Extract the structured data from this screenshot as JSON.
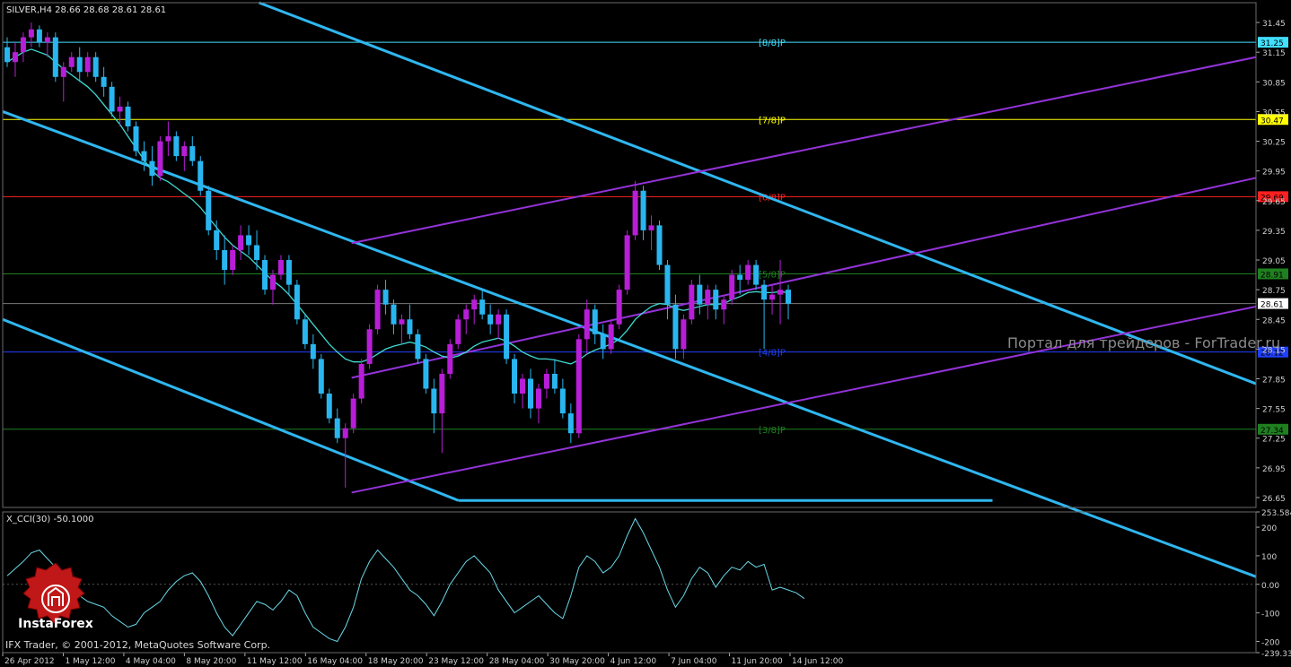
{
  "main_title": "SILVER,H4  28.66 28.68 28.61 28.61",
  "sub_title": "X_CCI(30) -50.1000",
  "watermark": "Портал для трейдеров - ForTrader.ru",
  "footer": "IFX Trader, © 2001-2012, MetaQuotes Software Corp.",
  "logo_text": "InstaForex",
  "price_ticks": [
    "31.45",
    "31.15",
    "30.85",
    "30.55",
    "30.25",
    "29.95",
    "29.65",
    "29.35",
    "29.05",
    "28.75",
    "28.45",
    "28.15",
    "27.85",
    "27.55",
    "27.25",
    "26.95",
    "26.65"
  ],
  "cci_ticks": [
    "253.584",
    "200",
    "100",
    "0.00",
    "-100",
    "-200",
    "-239.334"
  ],
  "x_ticks": [
    "26 Apr 2012",
    "1 May 12:00",
    "4 May 04:00",
    "8 May 20:00",
    "11 May 12:00",
    "16 May 04:00",
    "18 May 20:00",
    "23 May 12:00",
    "28 May 04:00",
    "30 May 20:00",
    "4 Jun 12:00",
    "7 Jun 04:00",
    "11 Jun 20:00",
    "14 Jun 12:00"
  ],
  "colors": {
    "background": "#000000",
    "bull": "#b81ed8",
    "bear": "#29b6f0",
    "ma": "#40d8d0",
    "cci": "#6ad8e8",
    "channel_blue": "#2fb7f0",
    "channel_purple": "#9333d8",
    "axis_text": "#d0d0d0"
  },
  "chart_data": [
    {
      "type": "candlestick",
      "title": "SILVER,H4",
      "ylim": [
        26.55,
        31.65
      ],
      "x_range": [
        0,
        176
      ],
      "last_price": 28.61,
      "murray_levels": [
        {
          "label": "[8/8]P",
          "price": 31.25,
          "color": "#40e0ff",
          "box_text": "31.25"
        },
        {
          "label": "[7/8]P",
          "price": 30.47,
          "color": "#ffff00",
          "box_text": "30.47"
        },
        {
          "label": "[6/8]P",
          "price": 29.69,
          "color": "#ff2020",
          "box_text": "29.69"
        },
        {
          "label": "[5/8]P",
          "price": 28.91,
          "color": "#208020",
          "box_text": "28.91"
        },
        {
          "label": "[4/8]P",
          "price": 28.12,
          "color": "#2040ff",
          "box_text": "28.12"
        },
        {
          "label": "[3/8]P",
          "price": 27.34,
          "color": "#208020",
          "box_text": "27.34"
        }
      ],
      "trend_lines": [
        {
          "color": "blue",
          "p1": [
            36,
            31.65
          ],
          "p2": [
            176,
            27.8
          ]
        },
        {
          "color": "blue",
          "p1": [
            0,
            30.55
          ],
          "p2": [
            176,
            25.85
          ]
        },
        {
          "color": "blue",
          "p1": [
            0,
            28.45
          ],
          "p2": [
            64,
            26.62
          ]
        },
        {
          "color": "blue",
          "p1": [
            64,
            26.62
          ],
          "p2": [
            139,
            26.62
          ]
        },
        {
          "color": "purple",
          "p1": [
            49,
            29.22
          ],
          "p2": [
            176,
            31.1
          ]
        },
        {
          "color": "purple",
          "p1": [
            49,
            27.86
          ],
          "p2": [
            176,
            29.88
          ]
        },
        {
          "color": "purple",
          "p1": [
            49,
            26.7
          ],
          "p2": [
            176,
            28.58
          ]
        }
      ],
      "ohlc": [
        [
          31.2,
          31.3,
          31.0,
          31.05
        ],
        [
          31.05,
          31.25,
          30.9,
          31.15
        ],
        [
          31.15,
          31.35,
          31.05,
          31.3
        ],
        [
          31.3,
          31.45,
          31.2,
          31.38
        ],
        [
          31.38,
          31.42,
          31.2,
          31.25
        ],
        [
          31.25,
          31.35,
          31.1,
          31.3
        ],
        [
          31.3,
          31.35,
          30.85,
          30.9
        ],
        [
          30.9,
          31.05,
          30.65,
          31.0
        ],
        [
          31.0,
          31.15,
          30.95,
          31.1
        ],
        [
          31.1,
          31.2,
          30.85,
          30.95
        ],
        [
          30.95,
          31.15,
          30.9,
          31.1
        ],
        [
          31.1,
          31.15,
          30.85,
          30.9
        ],
        [
          30.9,
          31.0,
          30.7,
          30.8
        ],
        [
          30.8,
          30.85,
          30.5,
          30.55
        ],
        [
          30.55,
          30.7,
          30.4,
          30.6
        ],
        [
          30.6,
          30.65,
          30.35,
          30.4
        ],
        [
          30.4,
          30.45,
          30.1,
          30.15
        ],
        [
          30.15,
          30.25,
          29.95,
          30.05
        ],
        [
          30.05,
          30.2,
          29.8,
          29.9
        ],
        [
          29.9,
          30.3,
          29.85,
          30.25
        ],
        [
          30.25,
          30.45,
          30.1,
          30.3
        ],
        [
          30.3,
          30.35,
          30.05,
          30.1
        ],
        [
          30.1,
          30.25,
          29.95,
          30.2
        ],
        [
          30.2,
          30.3,
          30.0,
          30.05
        ],
        [
          30.05,
          30.1,
          29.7,
          29.75
        ],
        [
          29.75,
          29.8,
          29.3,
          29.35
        ],
        [
          29.35,
          29.45,
          29.05,
          29.15
        ],
        [
          29.15,
          29.3,
          28.8,
          28.95
        ],
        [
          28.95,
          29.2,
          28.9,
          29.15
        ],
        [
          29.15,
          29.4,
          29.05,
          29.3
        ],
        [
          29.3,
          29.4,
          29.1,
          29.2
        ],
        [
          29.2,
          29.35,
          28.95,
          29.05
        ],
        [
          29.05,
          29.1,
          28.7,
          28.75
        ],
        [
          28.75,
          28.95,
          28.6,
          28.9
        ],
        [
          28.9,
          29.1,
          28.85,
          29.05
        ],
        [
          29.05,
          29.1,
          28.7,
          28.8
        ],
        [
          28.8,
          28.85,
          28.4,
          28.45
        ],
        [
          28.45,
          28.5,
          28.15,
          28.2
        ],
        [
          28.2,
          28.3,
          27.95,
          28.05
        ],
        [
          28.05,
          28.1,
          27.65,
          27.7
        ],
        [
          27.7,
          27.75,
          27.4,
          27.45
        ],
        [
          27.45,
          27.55,
          27.2,
          27.25
        ],
        [
          27.25,
          27.4,
          26.75,
          27.35
        ],
        [
          27.35,
          27.7,
          27.3,
          27.65
        ],
        [
          27.65,
          28.05,
          27.6,
          28.0
        ],
        [
          28.0,
          28.4,
          27.95,
          28.35
        ],
        [
          28.35,
          28.8,
          28.3,
          28.75
        ],
        [
          28.75,
          28.85,
          28.5,
          28.6
        ],
        [
          28.6,
          28.65,
          28.3,
          28.4
        ],
        [
          28.4,
          28.5,
          28.2,
          28.45
        ],
        [
          28.45,
          28.6,
          28.25,
          28.3
        ],
        [
          28.3,
          28.35,
          28.0,
          28.05
        ],
        [
          28.05,
          28.1,
          27.7,
          27.75
        ],
        [
          27.75,
          27.85,
          27.3,
          27.5
        ],
        [
          27.5,
          27.95,
          27.1,
          27.9
        ],
        [
          27.9,
          28.25,
          27.85,
          28.2
        ],
        [
          28.2,
          28.5,
          28.15,
          28.45
        ],
        [
          28.45,
          28.6,
          28.3,
          28.55
        ],
        [
          28.55,
          28.7,
          28.4,
          28.65
        ],
        [
          28.65,
          28.75,
          28.45,
          28.5
        ],
        [
          28.5,
          28.6,
          28.3,
          28.4
        ],
        [
          28.4,
          28.55,
          28.25,
          28.5
        ],
        [
          28.5,
          28.55,
          28.0,
          28.05
        ],
        [
          28.05,
          28.1,
          27.6,
          27.7
        ],
        [
          27.7,
          27.9,
          27.55,
          27.85
        ],
        [
          27.85,
          27.95,
          27.45,
          27.55
        ],
        [
          27.55,
          27.8,
          27.4,
          27.75
        ],
        [
          27.75,
          27.95,
          27.65,
          27.9
        ],
        [
          27.9,
          28.05,
          27.7,
          27.75
        ],
        [
          27.75,
          27.85,
          27.45,
          27.5
        ],
        [
          27.5,
          27.6,
          27.2,
          27.3
        ],
        [
          27.3,
          28.3,
          27.25,
          28.25
        ],
        [
          28.25,
          28.65,
          28.1,
          28.55
        ],
        [
          28.55,
          28.6,
          28.2,
          28.3
        ],
        [
          28.3,
          28.4,
          28.05,
          28.15
        ],
        [
          28.15,
          28.45,
          28.1,
          28.4
        ],
        [
          28.4,
          28.8,
          28.35,
          28.75
        ],
        [
          28.75,
          29.35,
          28.7,
          29.3
        ],
        [
          29.3,
          29.85,
          29.25,
          29.75
        ],
        [
          29.75,
          29.8,
          29.25,
          29.35
        ],
        [
          29.35,
          29.5,
          29.15,
          29.4
        ],
        [
          29.4,
          29.45,
          28.95,
          29.0
        ],
        [
          29.0,
          29.05,
          28.45,
          28.6
        ],
        [
          28.6,
          28.7,
          28.05,
          28.15
        ],
        [
          28.15,
          28.5,
          28.05,
          28.45
        ],
        [
          28.45,
          28.85,
          28.4,
          28.8
        ],
        [
          28.8,
          28.9,
          28.5,
          28.6
        ],
        [
          28.6,
          28.8,
          28.45,
          28.75
        ],
        [
          28.75,
          28.8,
          28.45,
          28.55
        ],
        [
          28.55,
          28.7,
          28.4,
          28.65
        ],
        [
          28.65,
          28.95,
          28.6,
          28.9
        ],
        [
          28.9,
          29.0,
          28.7,
          28.85
        ],
        [
          28.85,
          29.05,
          28.8,
          29.0
        ],
        [
          29.0,
          29.05,
          28.75,
          28.8
        ],
        [
          28.8,
          28.85,
          28.15,
          28.65
        ],
        [
          28.65,
          28.8,
          28.5,
          28.7
        ],
        [
          28.7,
          29.05,
          28.4,
          28.75
        ],
        [
          28.75,
          28.8,
          28.45,
          28.61
        ]
      ],
      "ma": [
        31.05,
        31.1,
        31.15,
        31.18,
        31.15,
        31.12,
        31.05,
        30.98,
        30.92,
        30.86,
        30.8,
        30.72,
        30.62,
        30.52,
        30.42,
        30.3,
        30.18,
        30.06,
        29.95,
        29.88,
        29.84,
        29.78,
        29.72,
        29.66,
        29.58,
        29.48,
        29.38,
        29.28,
        29.2,
        29.14,
        29.08,
        29.0,
        28.92,
        28.84,
        28.78,
        28.7,
        28.6,
        28.5,
        28.4,
        28.3,
        28.2,
        28.12,
        28.05,
        28.02,
        28.02,
        28.05,
        28.1,
        28.15,
        28.18,
        28.2,
        28.22,
        28.2,
        28.17,
        28.12,
        28.08,
        28.06,
        28.08,
        28.12,
        28.18,
        28.22,
        28.24,
        28.26,
        28.23,
        28.18,
        28.12,
        28.08,
        28.05,
        28.05,
        28.04,
        28.02,
        28.0,
        28.04,
        28.1,
        28.14,
        28.17,
        28.2,
        28.25,
        28.34,
        28.45,
        28.52,
        28.58,
        28.61,
        28.6,
        28.56,
        28.54,
        28.56,
        28.58,
        28.6,
        28.6,
        28.61,
        28.65,
        28.68,
        28.72,
        28.73,
        28.72,
        28.72,
        28.73,
        28.72
      ]
    },
    {
      "type": "line",
      "title": "X_CCI(30) -50.1000",
      "ylim": [
        -239.334,
        253.584
      ],
      "zero_line": 0,
      "values": [
        30,
        55,
        80,
        110,
        120,
        90,
        60,
        20,
        -10,
        -40,
        -60,
        -70,
        -80,
        -110,
        -130,
        -150,
        -140,
        -100,
        -80,
        -60,
        -20,
        10,
        30,
        40,
        10,
        -40,
        -100,
        -150,
        -180,
        -140,
        -100,
        -60,
        -70,
        -90,
        -60,
        -20,
        -40,
        -100,
        -150,
        -170,
        -190,
        -200,
        -150,
        -80,
        20,
        80,
        120,
        90,
        60,
        20,
        -20,
        -40,
        -70,
        -110,
        -60,
        0,
        40,
        80,
        100,
        70,
        40,
        -20,
        -60,
        -100,
        -80,
        -60,
        -40,
        -70,
        -100,
        -120,
        -40,
        60,
        100,
        80,
        40,
        60,
        100,
        170,
        230,
        180,
        120,
        60,
        -20,
        -80,
        -40,
        20,
        60,
        40,
        -10,
        30,
        60,
        50,
        80,
        60,
        70,
        -20,
        -10,
        -20,
        -30,
        -50
      ]
    }
  ]
}
